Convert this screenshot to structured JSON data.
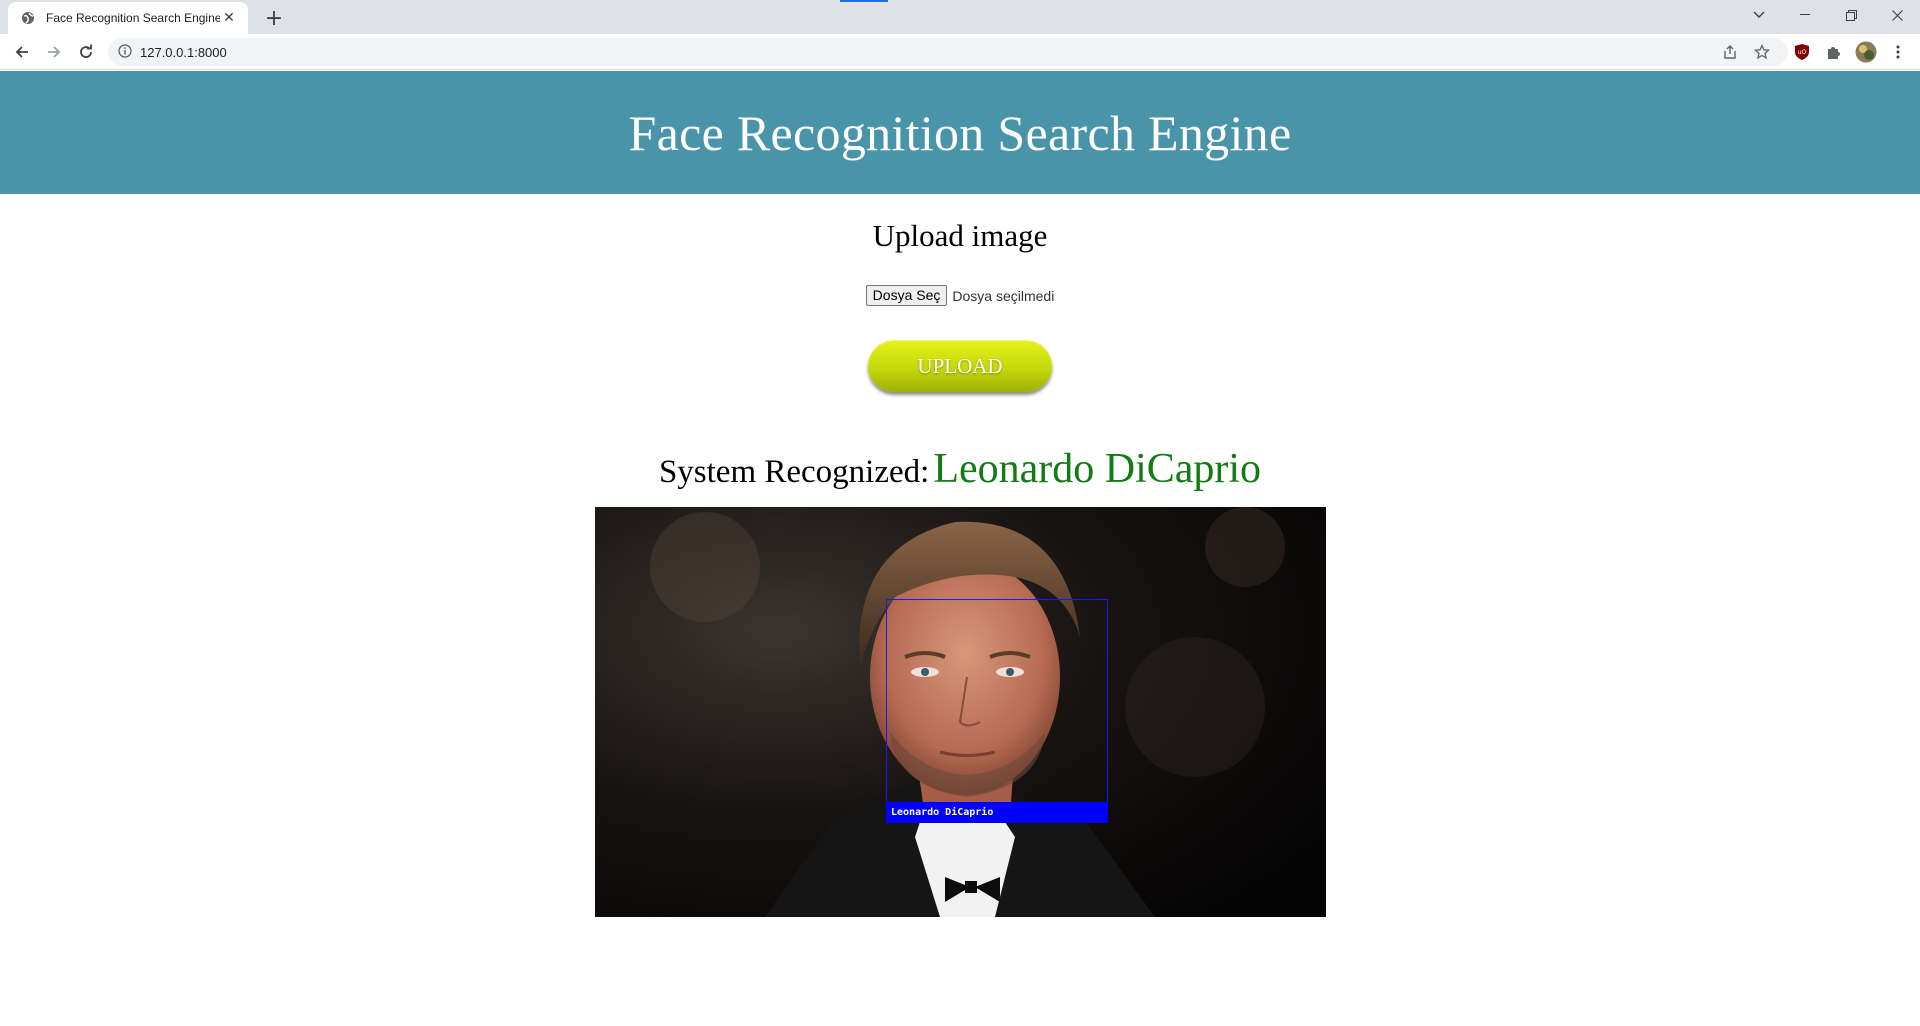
{
  "browser": {
    "tab_title": "Face Recognition Search Engine",
    "url": "127.0.0.1:8000"
  },
  "page": {
    "header_title": "Face Recognition Search Engine",
    "upload_heading": "Upload image",
    "file_input": {
      "button_label": "Dosya Seç",
      "status_text": "Dosya seçilmedi"
    },
    "upload_button_label": "UPLOAD",
    "result": {
      "label": "System Recognized:",
      "name": "Leonardo DiCaprio",
      "face_label": "Leonardo DiCaprio"
    }
  },
  "colors": {
    "header_bg": "#4a94aa",
    "upload_button": "#d4e60f",
    "result_name": "#137b13",
    "face_box": "#0000ff"
  }
}
